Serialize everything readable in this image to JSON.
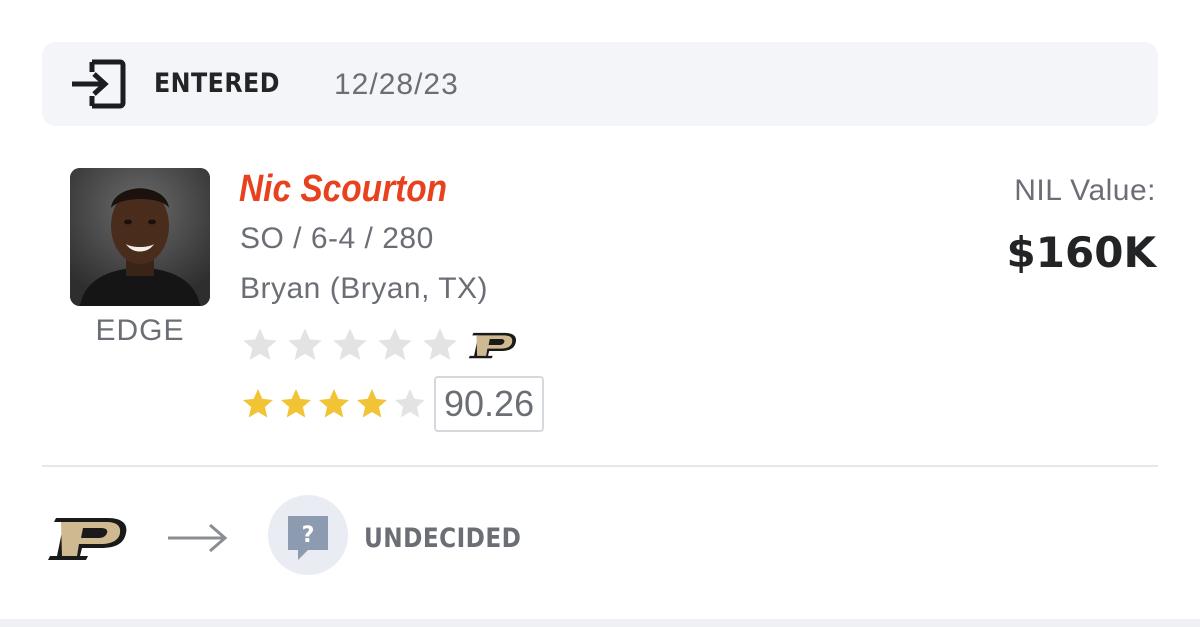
{
  "status": {
    "icon": "enter-icon",
    "label": "ENTERED",
    "date": "12/28/23"
  },
  "player": {
    "name": "Nic Scourton",
    "meta": "SO / 6-4 / 280",
    "hometown": "Bryan (Bryan, TX)",
    "position": "EDGE",
    "avatar_icon": "player-headshot",
    "school_rating": {
      "stars_filled": 0,
      "stars_total": 5,
      "school_logo": "purdue-p-logo"
    },
    "overall_rating": {
      "stars_filled": 4,
      "stars_total": 5,
      "score": "90.26"
    }
  },
  "nil": {
    "label": "NIL Value:",
    "value": "$160K"
  },
  "transfer": {
    "from_logo": "purdue-p-logo",
    "arrow_icon": "arrow-right-icon",
    "destination_icon": "question-mark-icon",
    "destination_label": "UNDECIDED"
  },
  "colors": {
    "accent": "#e8411e",
    "star_filled": "#f2c335",
    "star_empty": "#e3e3e3",
    "purdue_gold": "#cfb991",
    "text_dark": "#222426",
    "text_muted": "#6b6f75",
    "status_bg": "#f4f5f8"
  }
}
